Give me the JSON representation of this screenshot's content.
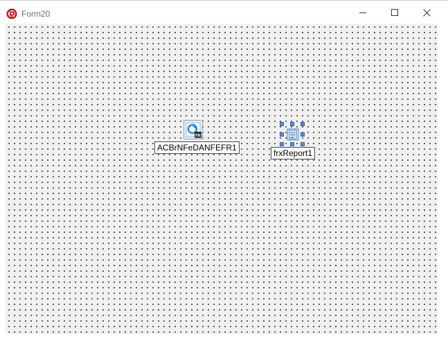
{
  "window": {
    "title": "Form20"
  },
  "icons": {
    "app": "delphi-app-icon",
    "minimize": "minimize-icon",
    "maximize": "maximize-icon",
    "close": "close-icon"
  },
  "components": [
    {
      "name": "ACBrNFeDANFEFR1",
      "icon": "acbr-danfe-fr-component-icon",
      "selected": false
    },
    {
      "name": "frxReport1",
      "icon": "fastreport-component-icon",
      "selected": true
    }
  ],
  "colors": {
    "designer_background": "#f0f0f0",
    "grid_dot": "#000000",
    "selection_handle": "#5a8fd6"
  }
}
